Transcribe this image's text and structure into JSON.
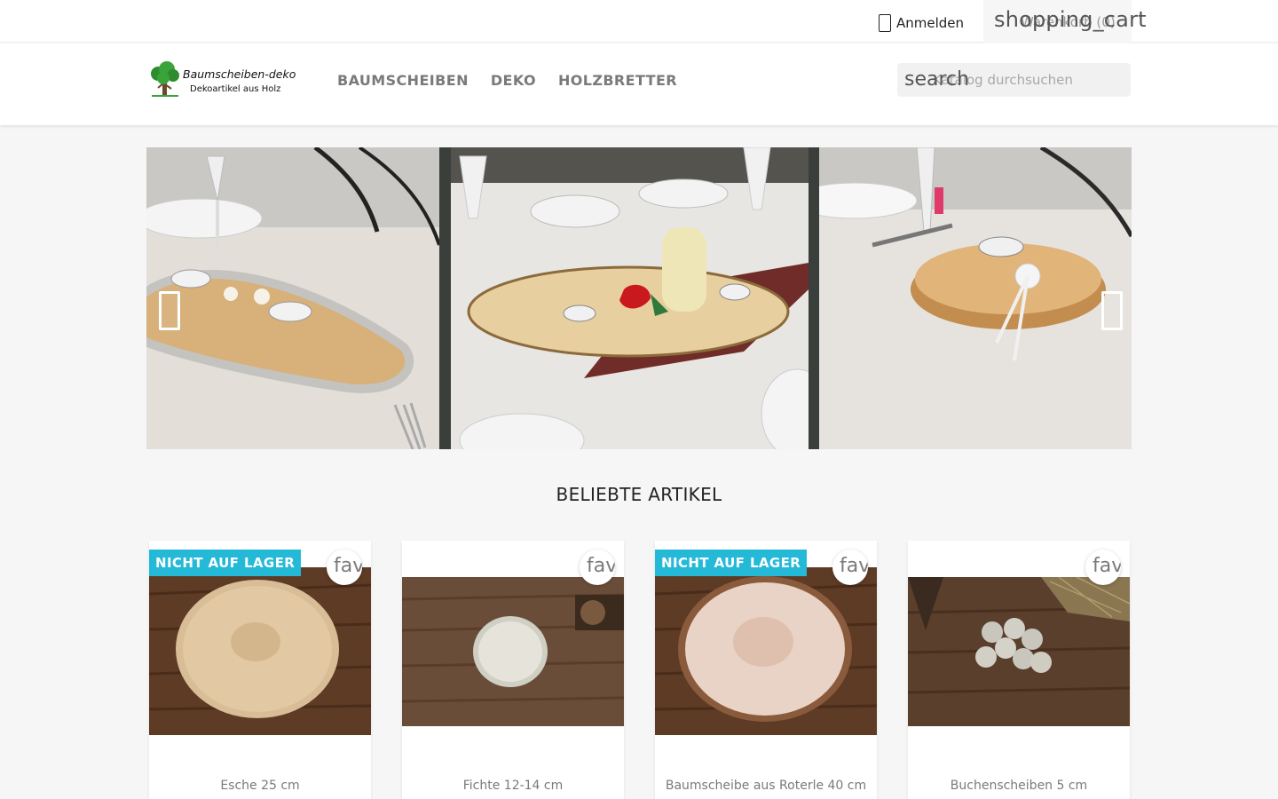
{
  "topbar": {
    "signin_label": "Anmelden",
    "cart_icon": "shopping_cart",
    "cart_label": "Warenkorb (0)"
  },
  "header": {
    "logo_title": "Baumscheiben-deko",
    "logo_subtitle": "Dekoartikel aus Holz",
    "nav": [
      "BAUMSCHEIBEN",
      "DEKO",
      "HOLZBRETTER"
    ],
    "search_icon": "search",
    "search_placeholder": "Katalog durchsuchen"
  },
  "carousel": {
    "prev_icon": "chevron-left-icon",
    "next_icon": "chevron-right-icon"
  },
  "section_title": "BELIEBTE ARTIKEL",
  "products": [
    {
      "name": "Esche 25 cm",
      "badge": "NICHT AUF LAGER",
      "fav_icon": "favorite_border"
    },
    {
      "name": "Fichte 12-14 cm",
      "badge": "",
      "fav_icon": "favorite_border"
    },
    {
      "name": "Baumscheibe aus Roterle 40 cm",
      "badge": "NICHT AUF LAGER",
      "fav_icon": "favorite_border"
    },
    {
      "name": "Buchenscheiben 5 cm",
      "badge": "",
      "fav_icon": "favorite_border"
    }
  ],
  "colors": {
    "accent_badge": "#24b9d7",
    "nav_text": "#7a7a7a",
    "text_dark": "#232323"
  }
}
